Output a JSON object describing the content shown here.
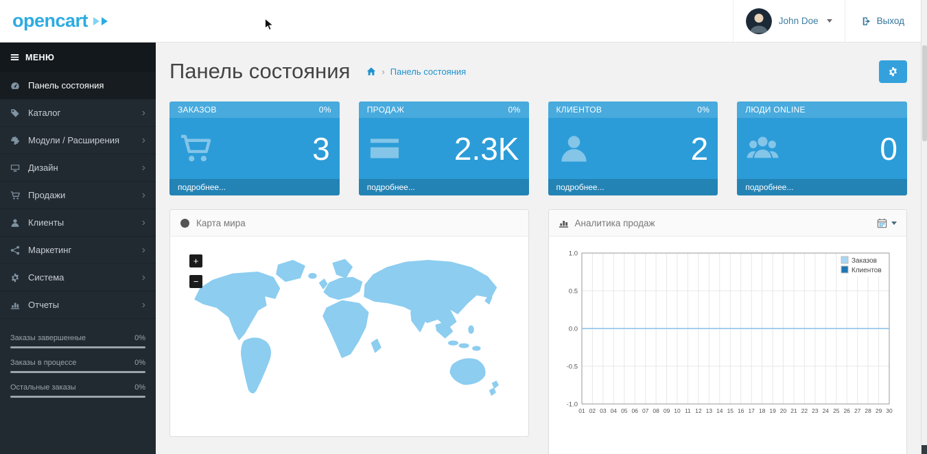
{
  "colors": {
    "accent": "#2f9cd8",
    "tile_blue": "#2b9cd8",
    "map_fill": "#8ccdf0",
    "link_blue": "#1e91cf",
    "logo_blue": "#2cabe1"
  },
  "header": {
    "logo_text": "opencart",
    "user_name": "John Doe",
    "logout_label": "Выход"
  },
  "sidebar": {
    "menu_title": "МЕНЮ",
    "items": [
      {
        "id": "dashboard",
        "label": "Панель состояния",
        "icon": "dashboard-icon",
        "active": true,
        "chevron": false
      },
      {
        "id": "catalog",
        "label": "Каталог",
        "icon": "tag-icon",
        "active": false,
        "chevron": true
      },
      {
        "id": "extensions",
        "label": "Модули / Расширения",
        "icon": "puzzle-icon",
        "active": false,
        "chevron": true
      },
      {
        "id": "design",
        "label": "Дизайн",
        "icon": "monitor-icon",
        "active": false,
        "chevron": true
      },
      {
        "id": "sales",
        "label": "Продажи",
        "icon": "cart-icon",
        "active": false,
        "chevron": true
      },
      {
        "id": "customers",
        "label": "Клиенты",
        "icon": "user-icon",
        "active": false,
        "chevron": true
      },
      {
        "id": "marketing",
        "label": "Маркетинг",
        "icon": "share-icon",
        "active": false,
        "chevron": true
      },
      {
        "id": "system",
        "label": "Система",
        "icon": "gear-icon",
        "active": false,
        "chevron": true
      },
      {
        "id": "reports",
        "label": "Отчеты",
        "icon": "bar-chart-icon",
        "active": false,
        "chevron": true
      }
    ],
    "stats": [
      {
        "label": "Заказы завершенные",
        "value": "0%",
        "percent": 0
      },
      {
        "label": "Заказы в процессе",
        "value": "0%",
        "percent": 0
      },
      {
        "label": "Остальные заказы",
        "value": "0%",
        "percent": 0
      }
    ]
  },
  "page": {
    "title": "Панель состояния",
    "breadcrumb": [
      "Панель состояния"
    ]
  },
  "tiles": [
    {
      "id": "orders",
      "label": "ЗАКАЗОВ",
      "percent": "0%",
      "value": "3",
      "icon": "shopping-cart-icon",
      "footer": "подробнее..."
    },
    {
      "id": "sales",
      "label": "ПРОДАЖ",
      "percent": "0%",
      "value": "2.3K",
      "icon": "credit-card-icon",
      "footer": "подробнее..."
    },
    {
      "id": "customers",
      "label": "КЛИЕНТОВ",
      "percent": "0%",
      "value": "2",
      "icon": "user-icon",
      "footer": "подробнее..."
    },
    {
      "id": "online",
      "label": "ЛЮДИ ONLINE",
      "percent": "",
      "value": "0",
      "icon": "users-icon",
      "footer": "подробнее..."
    }
  ],
  "map_panel": {
    "title": "Карта мира",
    "zoom_in": "+",
    "zoom_out": "−"
  },
  "chart_panel": {
    "title": "Аналитика продаж"
  },
  "chart_data": {
    "type": "line",
    "title": "Аналитика продаж",
    "x_labels": [
      "01",
      "02",
      "03",
      "04",
      "05",
      "06",
      "07",
      "08",
      "09",
      "10",
      "11",
      "12",
      "13",
      "14",
      "15",
      "16",
      "17",
      "18",
      "19",
      "20",
      "21",
      "22",
      "23",
      "24",
      "25",
      "26",
      "27",
      "28",
      "29",
      "30"
    ],
    "series": [
      {
        "name": "Заказов",
        "color": "#a8d5f2",
        "values": [
          0,
          0,
          0,
          0,
          0,
          0,
          0,
          0,
          0,
          0,
          0,
          0,
          0,
          0,
          0,
          0,
          0,
          0,
          0,
          0,
          0,
          0,
          0,
          0,
          0,
          0,
          0,
          0,
          0,
          0
        ]
      },
      {
        "name": "Клиентов",
        "color": "#1f77b4",
        "values": [
          0,
          0,
          0,
          0,
          0,
          0,
          0,
          0,
          0,
          0,
          0,
          0,
          0,
          0,
          0,
          0,
          0,
          0,
          0,
          0,
          0,
          0,
          0,
          0,
          0,
          0,
          0,
          0,
          0,
          0
        ]
      }
    ],
    "ylim": [
      -1.0,
      1.0
    ],
    "yticks": [
      1.0,
      0.5,
      0.0,
      -0.5,
      -1.0
    ],
    "grid": true,
    "legend_position": "top-right"
  }
}
